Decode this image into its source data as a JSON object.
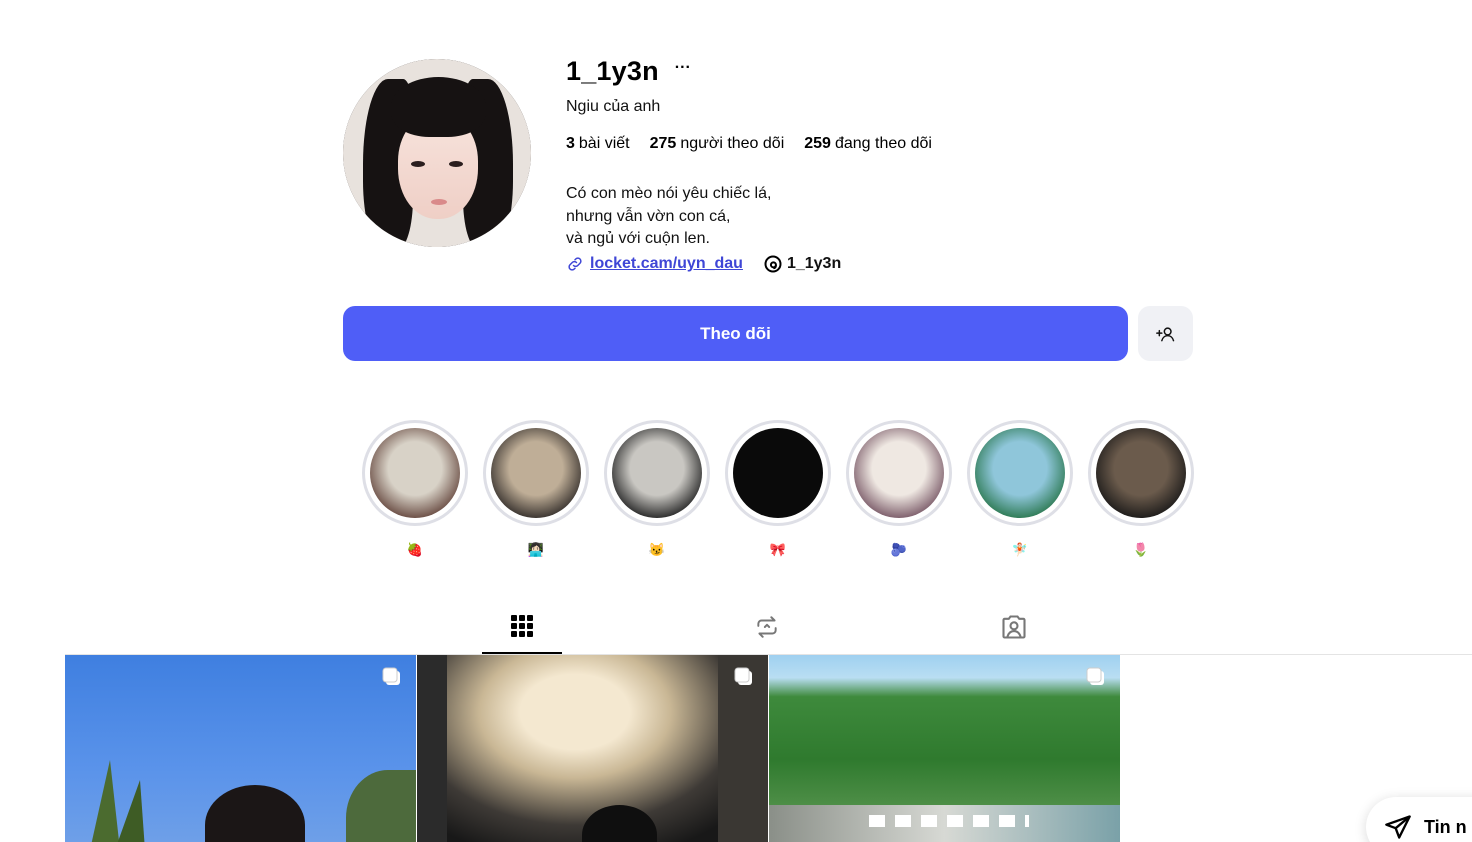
{
  "profile": {
    "username": "1_1y3n",
    "more": "···",
    "fullname": "Ngiu của anh",
    "stats": {
      "posts_count": "3",
      "posts_label": "bài viết",
      "followers_count": "275",
      "followers_label": "người theo dõi",
      "following_count": "259",
      "following_label": "đang theo dõi"
    },
    "bio": [
      "Có con mèo nói yêu chiếc lá,",
      "nhưng vẫn vờn con cá,",
      "và ngủ với cuộn len."
    ],
    "link": "locket.cam/uyn_dau",
    "threads_handle": "1_1y3n"
  },
  "actions": {
    "follow_label": "Theo dõi",
    "suggest_icon": "person-add-icon"
  },
  "highlights": [
    {
      "label": "🍓",
      "colors": [
        "#d8d2c7",
        "#6b4e45"
      ]
    },
    {
      "label": "👩🏻‍💻",
      "colors": [
        "#bfae97",
        "#3a3430"
      ]
    },
    {
      "label": "😼",
      "colors": [
        "#c9c7c2",
        "#2b2b2b"
      ]
    },
    {
      "label": "🎀",
      "colors": [
        "#0a0a0a",
        "#0a0a0a"
      ]
    },
    {
      "label": "🫐",
      "colors": [
        "#efe8e2",
        "#7d5e6b"
      ]
    },
    {
      "label": "🧚🏻",
      "colors": [
        "#8fc6da",
        "#2f7b55"
      ]
    },
    {
      "label": "🌷",
      "colors": [
        "#6b5b4c",
        "#1e1c1b"
      ]
    }
  ],
  "tabs": [
    {
      "name": "posts",
      "icon": "grid-icon",
      "active": true
    },
    {
      "name": "reposts",
      "icon": "repost-icon",
      "active": false
    },
    {
      "name": "tagged",
      "icon": "tagged-icon",
      "active": false
    }
  ],
  "messages": {
    "label": "Tin n"
  }
}
